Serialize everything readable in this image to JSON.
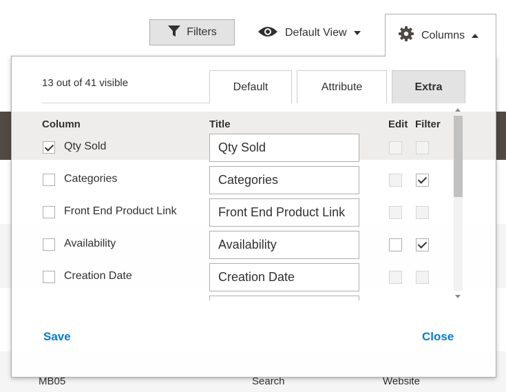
{
  "toolbar": {
    "filters_label": "Filters",
    "view_label": "Default View",
    "columns_label": "Columns"
  },
  "panel": {
    "visible_count": "13 out of 41 visible",
    "tabs": [
      {
        "label": "Default",
        "active": false
      },
      {
        "label": "Attribute",
        "active": false
      },
      {
        "label": "Extra",
        "active": true
      }
    ],
    "headers": {
      "column": "Column",
      "title": "Title",
      "edit": "Edit",
      "filter": "Filter"
    },
    "rows": [
      {
        "label": "Qty Sold",
        "title": "Qty Sold",
        "visible": true,
        "edit_enabled": false,
        "filter_enabled": false,
        "filter_checked": false
      },
      {
        "label": "Categories",
        "title": "Categories",
        "visible": false,
        "edit_enabled": false,
        "filter_enabled": true,
        "filter_checked": true
      },
      {
        "label": "Front End Product Link",
        "title": "Front End Product Link",
        "visible": false,
        "edit_enabled": false,
        "filter_enabled": false,
        "filter_checked": false
      },
      {
        "label": "Availability",
        "title": "Availability",
        "visible": false,
        "edit_enabled": true,
        "filter_enabled": true,
        "filter_checked": true
      },
      {
        "label": "Creation Date",
        "title": "Creation Date",
        "visible": false,
        "edit_enabled": false,
        "filter_enabled": false,
        "filter_checked": false
      },
      {
        "label": "",
        "title": "",
        "visible": false,
        "edit_enabled": false,
        "filter_enabled": false,
        "filter_checked": false
      }
    ],
    "save_label": "Save",
    "close_label": "Close"
  },
  "background_grid": {
    "bottom_row": {
      "sku": "MB05",
      "visibility": "Search",
      "websites": "Website"
    }
  },
  "colors": {
    "link": "#007bdb",
    "active_tab": "#e3e3e3",
    "border": "#adadad"
  },
  "icons": {
    "filters": "funnel-icon",
    "view": "eye-icon",
    "columns": "gear-icon"
  }
}
